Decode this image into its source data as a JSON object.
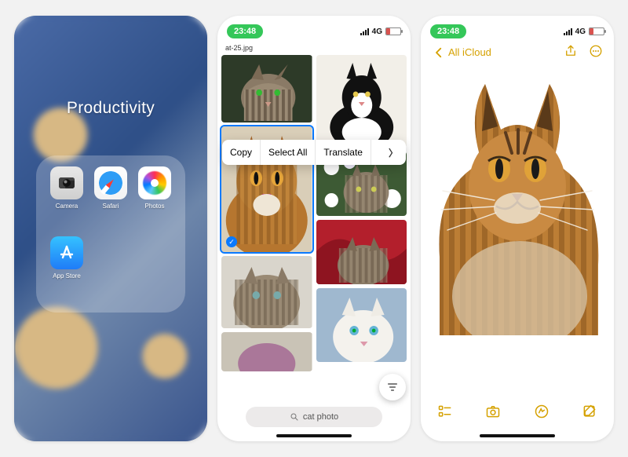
{
  "screen1": {
    "folder_title": "Productivity",
    "apps": [
      {
        "label": "Camera",
        "icon": "camera-icon"
      },
      {
        "label": "Safari",
        "icon": "safari-icon"
      },
      {
        "label": "Photos",
        "icon": "photos-icon"
      },
      {
        "label": "App Store",
        "icon": "appstore-icon"
      }
    ]
  },
  "screen2": {
    "status_time": "23:48",
    "cell_label": "4G",
    "filename": "at-25.jpg",
    "context_menu": {
      "copy": "Copy",
      "select_all": "Select All",
      "translate": "Translate"
    },
    "search_placeholder": "cat photo",
    "filter_icon": "filter-icon"
  },
  "screen3": {
    "status_time": "23:48",
    "cell_label": "4G",
    "back_label": "All iCloud",
    "toolbar": {
      "checklist": "checklist-icon",
      "camera": "camera-icon",
      "draw": "draw-icon",
      "compose": "compose-icon"
    },
    "actions": {
      "share": "share-icon",
      "more": "more-icon"
    }
  },
  "colors": {
    "notes_accent": "#d5a100",
    "ios_green": "#34c759",
    "ios_blue": "#0a7aff"
  }
}
